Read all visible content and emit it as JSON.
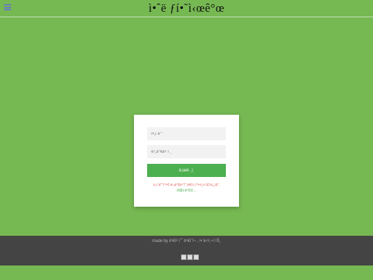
{
  "header": {
    "title": "ì•ˆë ƒí•˜ì‹œê°œ",
    "menu_icon": "hamburger-menu-icon"
  },
  "login_form": {
    "id_placeholder": "ì•„ì´ë””",
    "password_placeholder": "ë¹„ë°€ë²ˆí˜¸",
    "login_button_label": "ë¡œê·¸ì¸",
    "message_prefix": "ì•„ì´ë””ì™€ ë¹„ë°€ë²ˆí˜¸ë¥¼ í™•ì¸í•´ì£¼ì„¸ìš”.",
    "message_link": "íšŒì›ê°€ìž…"
  },
  "footer": {
    "made_by_text": "made by ê¹€ì² ìˆ˜ ê¹€ì˜í¬ , í•´ë‹¹ì‚¬ì´íŠ¸",
    "social_icons": [
      "broken-image-icon",
      "broken-image-icon",
      "broken-image-icon"
    ]
  },
  "colors": {
    "background": "#76b852",
    "button": "#4caf50",
    "footer": "#444444"
  }
}
